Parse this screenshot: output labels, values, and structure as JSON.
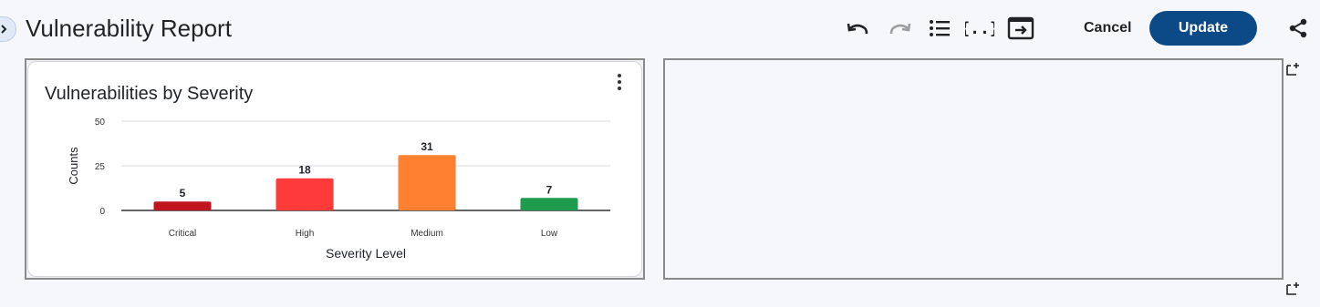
{
  "header": {
    "title": "Vulnerability Report",
    "cancel_label": "Cancel",
    "update_label": "Update",
    "icons": [
      "undo-icon",
      "redo-icon",
      "list-icon",
      "braces-icon",
      "export-icon",
      "share-icon"
    ]
  },
  "card": {
    "title": "Vulnerabilities by Severity"
  },
  "chart_data": {
    "type": "bar",
    "title": "Vulnerabilities by Severity",
    "xlabel": "Severity Level",
    "ylabel": "Counts",
    "categories": [
      "Critical",
      "High",
      "Medium",
      "Low"
    ],
    "values": [
      5,
      18,
      31,
      7
    ],
    "colors": [
      "#c0141f",
      "#ff3a3a",
      "#ff8030",
      "#1f9b4e"
    ],
    "ylim": [
      0,
      50
    ],
    "yticks": [
      0,
      25,
      50
    ],
    "grid": true,
    "legend": "none"
  },
  "colors": {
    "accent": "#0b4a86",
    "background": "#f6f7fb"
  }
}
